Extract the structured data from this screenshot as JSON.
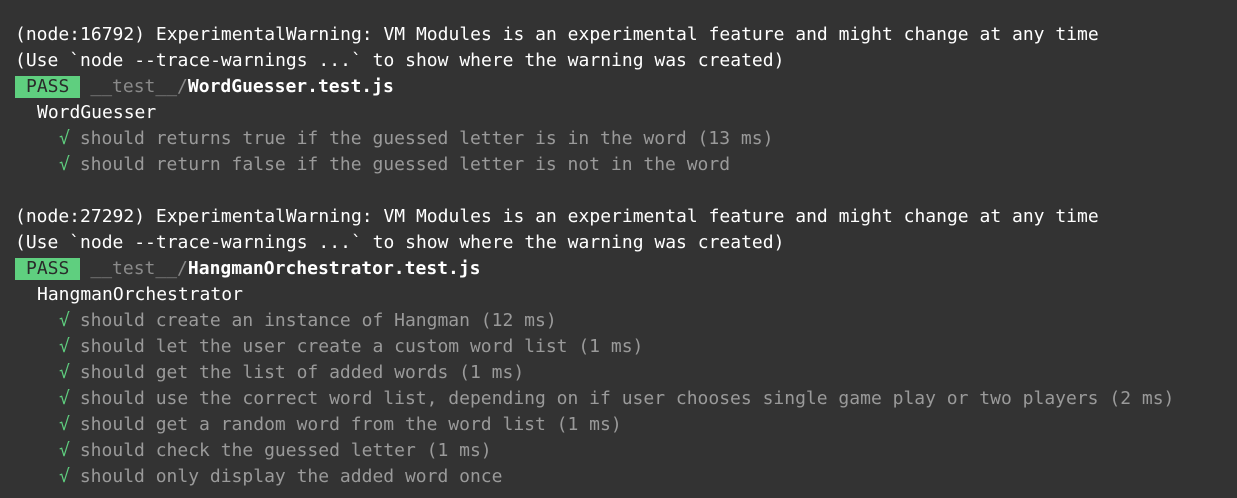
{
  "blocks": [
    {
      "warning_line1": "(node:16792) ExperimentalWarning: VM Modules is an experimental feature and might change at any time",
      "warning_line2": "(Use `node --trace-warnings ...` to show where the warning was created)",
      "status": "PASS",
      "path_dir": "__test__/",
      "path_file": "WordGuesser.test.js",
      "suite": "WordGuesser",
      "tests": [
        {
          "mark": "√",
          "text": "should returns true if the guessed letter is in the word (13 ms)"
        },
        {
          "mark": "√",
          "text": "should return false if the guessed letter is not in the word"
        }
      ]
    },
    {
      "warning_line1": "(node:27292) ExperimentalWarning: VM Modules is an experimental feature and might change at any time",
      "warning_line2": "(Use `node --trace-warnings ...` to show where the warning was created)",
      "status": "PASS",
      "path_dir": "__test__/",
      "path_file": "HangmanOrchestrator.test.js",
      "suite": "HangmanOrchestrator",
      "tests": [
        {
          "mark": "√",
          "text": "should create an instance of Hangman (12 ms)"
        },
        {
          "mark": "√",
          "text": "should let the user create a custom word list (1 ms)"
        },
        {
          "mark": "√",
          "text": "should get the list of added words (1 ms)"
        },
        {
          "mark": "√",
          "text": "should use the correct word list, depending on if user chooses single game play or two players (2 ms)"
        },
        {
          "mark": "√",
          "text": "should get a random word from the word list (1 ms)"
        },
        {
          "mark": "√",
          "text": "should check the guessed letter (1 ms)"
        },
        {
          "mark": "√",
          "text": "should only display the added word once"
        }
      ]
    }
  ],
  "colors": {
    "background": "#333333",
    "pass_badge": "#5fcf7f",
    "check": "#5fcf7f"
  }
}
